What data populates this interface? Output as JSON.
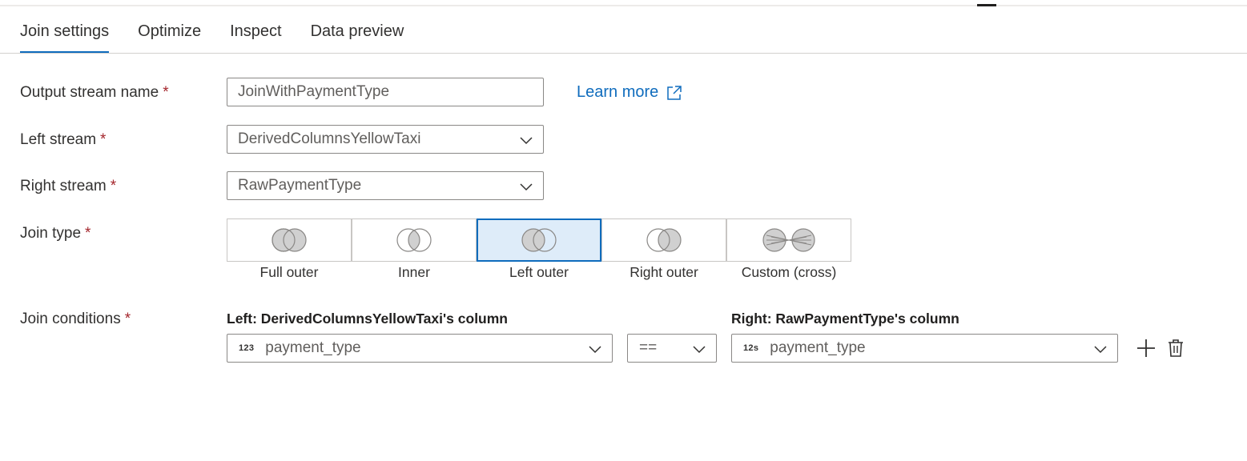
{
  "tabs": [
    {
      "label": "Join settings",
      "active": true
    },
    {
      "label": "Optimize",
      "active": false
    },
    {
      "label": "Inspect",
      "active": false
    },
    {
      "label": "Data preview",
      "active": false
    }
  ],
  "form": {
    "output_stream": {
      "label": "Output stream name",
      "required_mark": "*",
      "value": "JoinWithPaymentType"
    },
    "learn_more": {
      "label": "Learn more",
      "icon": "external-link-icon"
    },
    "left_stream": {
      "label": "Left stream",
      "required_mark": "*",
      "value": "DerivedColumnsYellowTaxi"
    },
    "right_stream": {
      "label": "Right stream",
      "required_mark": "*",
      "value": "RawPaymentType"
    },
    "join_type": {
      "label": "Join type",
      "required_mark": "*",
      "selected": "Left outer",
      "options": [
        {
          "label": "Full outer",
          "icon": "venn-full-outer-icon"
        },
        {
          "label": "Inner",
          "icon": "venn-inner-icon"
        },
        {
          "label": "Left outer",
          "icon": "venn-left-outer-icon"
        },
        {
          "label": "Right outer",
          "icon": "venn-right-outer-icon"
        },
        {
          "label": "Custom (cross)",
          "icon": "venn-cross-icon"
        }
      ]
    },
    "join_conditions": {
      "label": "Join conditions",
      "required_mark": "*",
      "left_header": "Left: DerivedColumnsYellowTaxi's column",
      "right_header": "Right: RawPaymentType's column",
      "left_type_badge": "123",
      "left_value": "payment_type",
      "operator": "==",
      "right_type_badge": "12s",
      "right_value": "payment_type"
    }
  },
  "colors": {
    "accent": "#0f6cbd",
    "required": "#a4262c",
    "selected_bg": "#deecf9",
    "venn_fill": "#d0d0d0",
    "venn_stroke": "#8a8886"
  }
}
